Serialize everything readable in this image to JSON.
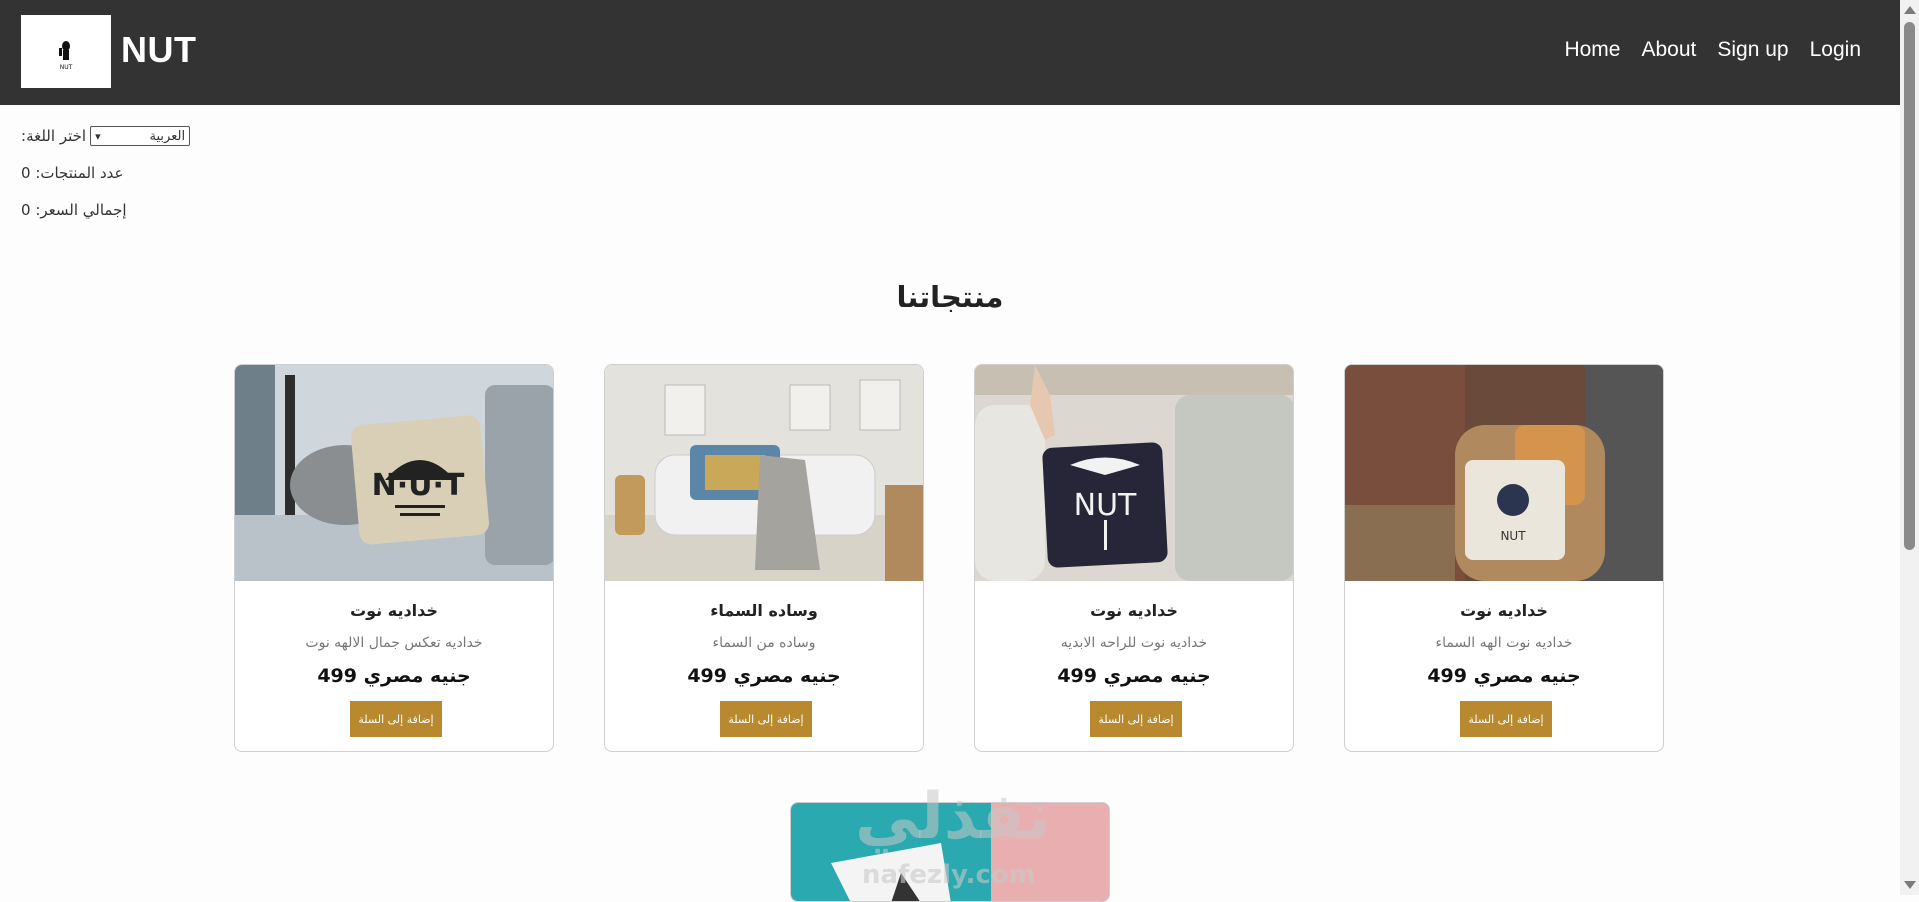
{
  "header": {
    "brand": "NUT",
    "logo_text": "NUT",
    "nav": [
      "Home",
      "About",
      "Sign up",
      "Login"
    ]
  },
  "language": {
    "label": ":اختر اللغة",
    "selected": "العربية"
  },
  "stats": {
    "count_label": "عدد المنتجات: 0",
    "total_label": "إجمالي السعر: 0"
  },
  "section_title": "منتجاتنا",
  "products": [
    {
      "title": "خداديه نوت",
      "desc": "خداديه تعكس جمال الالهه نوت",
      "price": "499 جنيه مصري",
      "button": "إضافة إلى السلة",
      "image": "pillow-hieroglyph-beige"
    },
    {
      "title": "وساده السماء",
      "desc": "وساده من السماء",
      "price": "499 جنيه مصري",
      "button": "إضافة إلى السلة",
      "image": "pillow-egyptian-art-sofa"
    },
    {
      "title": "خداديه نوت",
      "desc": "خداديه نوت للراحه الابديه",
      "price": "499 جنيه مصري",
      "button": "إضافة إلى السلة",
      "image": "pillow-navy-nut"
    },
    {
      "title": "خداديه نوت",
      "desc": "خداديه نوت الهه السماء",
      "price": "499 جنيه مصري",
      "button": "إضافة إلى السلة",
      "image": "pillow-wicker-chair"
    }
  ],
  "watermark": {
    "arabic": "نفذلي",
    "latin": "nafezly.com"
  },
  "icons": {
    "select_chevron": "chevron-down-icon"
  },
  "colors": {
    "header_bg": "#333333",
    "button_bg": "#b8892e"
  }
}
